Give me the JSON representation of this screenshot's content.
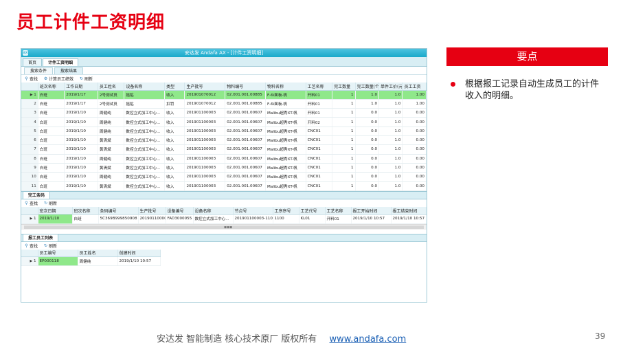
{
  "slide": {
    "title": "员工计件工资明细",
    "key_header": "要点",
    "bullet": "根据报工记录自动生成员工的计件收入的明细。",
    "footer_text": "安达发   智能制造 核心技术原厂   版权所有",
    "footer_link": "www.andafa.com",
    "page_number": "39"
  },
  "app": {
    "window_title": "安达发 Andafa AX - [计件工资明细]",
    "tabs": [
      "首页",
      "计件工资明细"
    ],
    "subtabs": [
      "搜索条件",
      "搜索结果"
    ],
    "toolbar1": {
      "find": "查找",
      "calc": "计算员工绩效",
      "refresh": "刷新"
    },
    "grid1": {
      "headers": [
        "班次名称",
        "工作日期",
        "员工姓名",
        "设备名称",
        "类型",
        "生产批号",
        "物料编号",
        "物料名称",
        "工艺名称",
        "完工数量",
        "完工数量(个人)",
        "单件工价(元)",
        "员工工资"
      ],
      "rows": [
        [
          "1",
          "白班",
          "2019/1/17",
          "2号测试员",
          "摇贴",
          "收入",
          "201901070012",
          "02.001.001.00885",
          "F-6i面板-帆",
          "开料01",
          "1",
          "1.0",
          "1.0",
          "1.00"
        ],
        [
          "2",
          "白班",
          "2019/1/17",
          "2号测试员",
          "摇贴",
          "扣罚",
          "201901070012",
          "02.001.001.00885",
          "F-6i面板-帆",
          "开料01",
          "1",
          "1.0",
          "1.0",
          "1.00"
        ],
        [
          "3",
          "白班",
          "2019/1/10",
          "周健纯",
          "数控立式加工中心...",
          "收入",
          "201901100003",
          "02.001.001.00607",
          "Malibu超秀XT-帆",
          "开料01",
          "1",
          "0.0",
          "1.0",
          "0.00"
        ],
        [
          "4",
          "白班",
          "2019/1/10",
          "周健纯",
          "数控立式加工中心...",
          "收入",
          "201901100003",
          "02.001.001.00607",
          "Malibu超秀XT-帆",
          "开料02",
          "1",
          "0.0",
          "1.0",
          "0.00"
        ],
        [
          "5",
          "白班",
          "2019/1/10",
          "周健纯",
          "数控立式加工中心...",
          "收入",
          "201901100003",
          "02.001.001.00607",
          "Malibu超秀XT-帆",
          "CNC01",
          "1",
          "0.0",
          "1.0",
          "0.00"
        ],
        [
          "6",
          "白班",
          "2019/1/10",
          "黄清斌",
          "数控立式加工中心...",
          "收入",
          "201901100003",
          "02.001.001.00607",
          "Malibu超秀XT-帆",
          "CNC01",
          "1",
          "0.0",
          "1.0",
          "0.00"
        ],
        [
          "7",
          "白班",
          "2019/1/10",
          "黄清斌",
          "数控立式加工中心...",
          "收入",
          "201901100003",
          "02.001.001.00607",
          "Malibu超秀XT-帆",
          "CNC01",
          "1",
          "0.0",
          "1.0",
          "0.00"
        ],
        [
          "8",
          "白班",
          "2019/1/10",
          "周健纯",
          "数控立式加工中心...",
          "收入",
          "201901100003",
          "02.001.001.00607",
          "Malibu超秀XT-帆",
          "CNC01",
          "1",
          "0.0",
          "1.0",
          "0.00"
        ],
        [
          "9",
          "白班",
          "2019/1/10",
          "黄清斌",
          "数控立式加工中心...",
          "收入",
          "201901100003",
          "02.001.001.00607",
          "Malibu超秀XT-帆",
          "CNC01",
          "1",
          "0.0",
          "1.0",
          "0.00"
        ],
        [
          "10",
          "白班",
          "2019/1/10",
          "周健纯",
          "数控立式加工中心...",
          "收入",
          "201901100003",
          "02.001.001.00607",
          "Malibu超秀XT-帆",
          "CNC01",
          "1",
          "0.0",
          "1.0",
          "0.00"
        ],
        [
          "11",
          "白班",
          "2019/1/10",
          "黄清斌",
          "数控立式加工中心...",
          "收入",
          "201901100003",
          "02.001.001.00607",
          "Malibu超秀XT-帆",
          "CNC01",
          "1",
          "0.0",
          "1.0",
          "0.00"
        ]
      ]
    },
    "section2_tab": "完工条码",
    "toolbar2": {
      "find": "查找",
      "refresh": "刷新"
    },
    "grid2": {
      "headers": [
        "班次日期",
        "班次名称",
        "条码编号",
        "生产批号",
        "设备编号",
        "设备名称",
        "节点号",
        "工序序号",
        "工艺代号",
        "工艺名称",
        "报工开始时间",
        "报工结束时间"
      ],
      "rows": [
        [
          "1",
          "2019/1/10",
          "白班",
          "5C369B999850908",
          "201901100003",
          "FAD3000055",
          "数控立式加工中心...",
          "201901100003-1100",
          "1100",
          "KL01",
          "开料01",
          "2019/1/10 10:57",
          "2019/1/10 10:57"
        ]
      ]
    },
    "section3_tab": "报工员工列表",
    "toolbar3": {
      "find": "查找",
      "refresh": "刷新"
    },
    "grid3": {
      "headers": [
        "员工编号",
        "员工姓名",
        "创建时间"
      ],
      "rows": [
        [
          "1",
          "EP000118",
          "周健纯",
          "2019/1/10 10:57"
        ]
      ]
    }
  }
}
